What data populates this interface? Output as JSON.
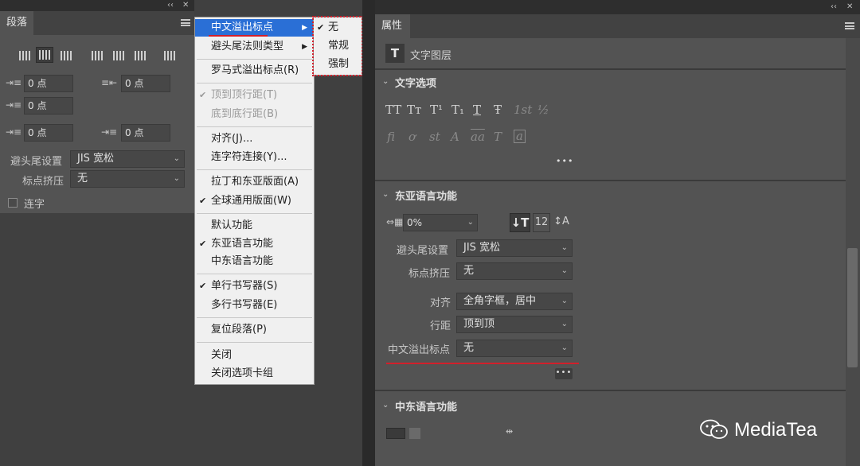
{
  "paragraph_panel": {
    "collapse_glyph": "‹‹",
    "close_glyph": "✕",
    "tab_title": "段落",
    "align_buttons": [
      "align-left",
      "align-center",
      "align-right",
      "justify-last-left",
      "justify-last-center",
      "justify-last-right",
      "justify-all"
    ],
    "indent_left_value": "0 点",
    "indent_right_value": "0 点",
    "indent_first_line_value": "0 点",
    "space_before_value": "0 点",
    "space_after_value": "0 点",
    "kinsoku_label": "避头尾设置",
    "kinsoku_value": "JIS 宽松",
    "mojikumi_label": "标点挤压",
    "mojikumi_value": "无",
    "hyphenate_label": "连字"
  },
  "menu": {
    "items": [
      {
        "label": "中文溢出标点",
        "highlighted": true,
        "submenu": true
      },
      {
        "label": "避头尾法则类型",
        "submenu": true
      },
      {
        "label": "罗马式溢出标点(R)"
      },
      {
        "label": "顶到顶行距(T)",
        "checked": true,
        "disabled": true
      },
      {
        "label": "底到底行距(B)",
        "disabled": true
      },
      {
        "label": "对齐(J)..."
      },
      {
        "label": "连字符连接(Y)..."
      },
      {
        "label": "拉丁和东亚版面(A)"
      },
      {
        "label": "全球通用版面(W)",
        "checked": true
      },
      {
        "label": "默认功能"
      },
      {
        "label": "东亚语言功能",
        "checked": true
      },
      {
        "label": "中东语言功能"
      },
      {
        "label": "单行书写器(S)",
        "checked": true
      },
      {
        "label": "多行书写器(E)"
      },
      {
        "label": "复位段落(P)"
      },
      {
        "label": "关闭"
      },
      {
        "label": "关闭选项卡组"
      }
    ],
    "submenu_items": [
      {
        "label": "无",
        "checked": true
      },
      {
        "label": "常规"
      },
      {
        "label": "强制"
      }
    ]
  },
  "properties_panel": {
    "collapse_glyph": "‹‹",
    "close_glyph": "✕",
    "tab_title": "属性",
    "layer_icon": "T",
    "layer_type": "文字图层",
    "text_options_title": "文字选项",
    "style_glyphs_row1": [
      "TT",
      "Tт",
      "T¹",
      "T₁",
      "T",
      "Ŧ",
      "1st",
      "½"
    ],
    "style_glyphs_row2": [
      "ﬁ",
      "ơ",
      "st",
      "A",
      "aa",
      "T",
      "a"
    ],
    "more_glyph": "•••",
    "east_asian_title": "东亚语言功能",
    "tsume_value": "0%",
    "kinsoku_label": "避头尾设置",
    "kinsoku_value": "JIS 宽松",
    "mojikumi_label": "标点挤压",
    "mojikumi_value": "无",
    "align_label": "对齐",
    "align_value": "全角字框，居中",
    "leading_label": "行距",
    "leading_value": "顶到顶",
    "burasagari_label": "中文溢出标点",
    "burasagari_value": "无",
    "middle_east_title": "中东语言功能"
  },
  "watermark": {
    "text": "MediaTea"
  },
  "colors": {
    "panel": "#535353",
    "menu_highlight": "#2a6fd6",
    "annotation_red": "#d21f2b"
  }
}
